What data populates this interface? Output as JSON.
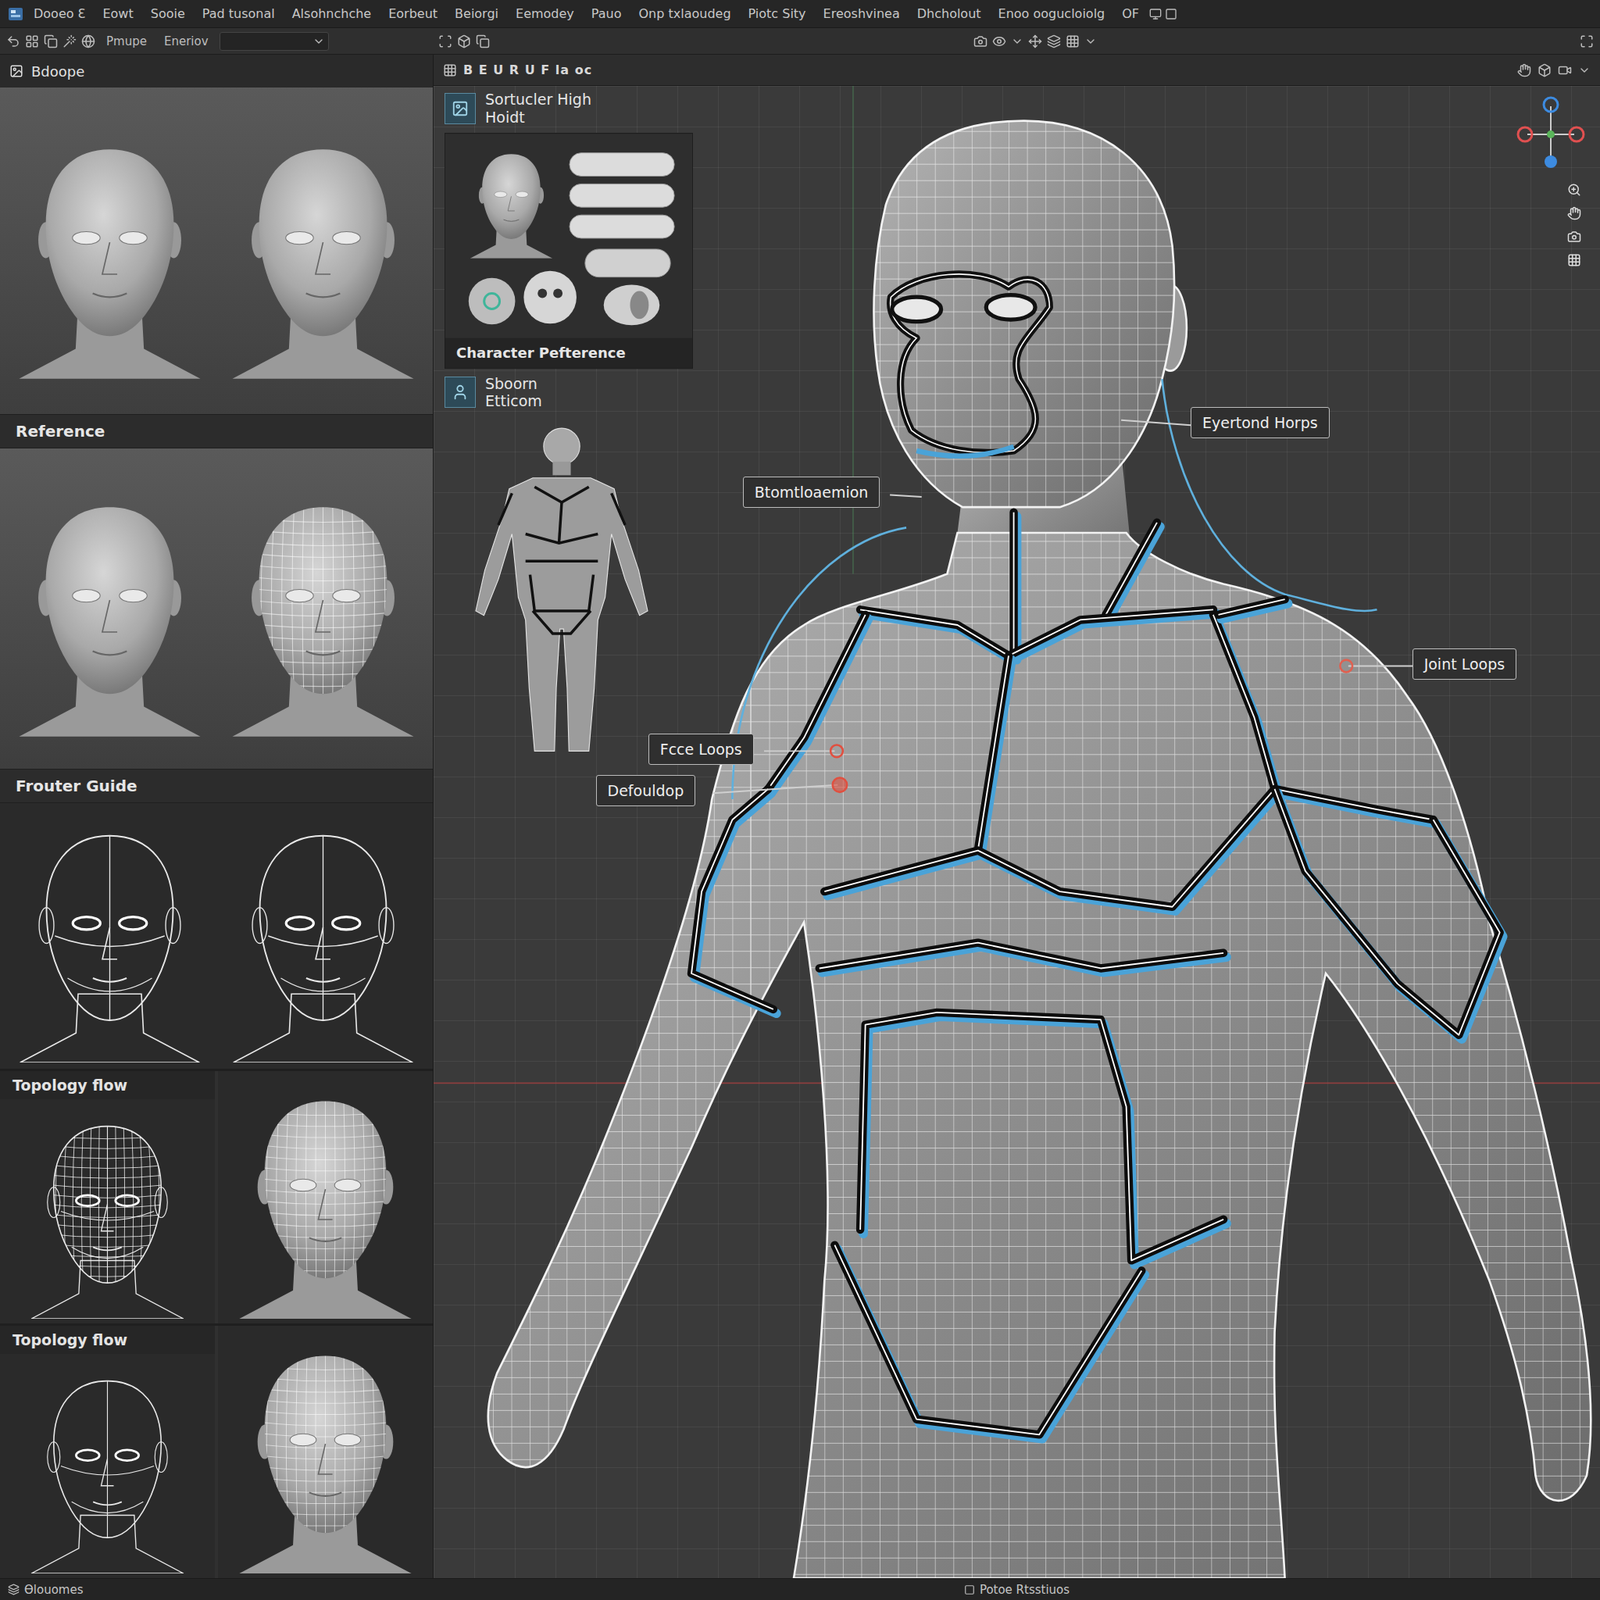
{
  "window": {
    "title": "Bdoope"
  },
  "menu": [
    "Dooeo Ɛ",
    "Eowt",
    "Sooie",
    "Pad tusonal",
    "Alsohnchche",
    "Eorbeut",
    "Beiorgi",
    "Eemodey",
    "Pauo",
    "Onp txlaoudeg",
    "Piotc Sity",
    "Ereoshvinea",
    "Dhcholout",
    "Enoo oogucloiolg",
    "OF"
  ],
  "toolbar": {
    "labels": [
      "Pmupe",
      "Eneriov"
    ]
  },
  "left_panel": {
    "title": "Bdoope",
    "sections": [
      {
        "heads": [
          {
            "kind": "solid"
          },
          {
            "kind": "solid"
          }
        ],
        "caption": "Reference"
      },
      {
        "heads": [
          {
            "kind": "solid"
          },
          {
            "kind": "mesh"
          }
        ],
        "caption": "Frouter Guide"
      },
      {
        "heads": [
          {
            "kind": "line"
          },
          {
            "kind": "line"
          }
        ],
        "caption": ""
      }
    ],
    "grid": [
      {
        "label": "Topology flow",
        "heads": [
          {
            "kind": "wire"
          },
          {
            "kind": "mesh"
          }
        ]
      },
      {
        "label": "Topology flow",
        "heads": [
          {
            "kind": "line"
          },
          {
            "kind": "mesh"
          }
        ]
      }
    ]
  },
  "viewport": {
    "header": "B E U R U F la oc",
    "cards": [
      {
        "title": [
          "Sortucler High",
          "Hoidt"
        ],
        "caption": "Character Pefterence",
        "kind": "reference"
      },
      {
        "title": [
          "Sboorn",
          "Etticom"
        ],
        "caption": "",
        "kind": "body"
      }
    ],
    "callouts": [
      {
        "label": "Eyertond Horps"
      },
      {
        "label": "Btomtloaemion"
      },
      {
        "label": "Joint Loops"
      },
      {
        "label": "Fcce Loops"
      },
      {
        "label": "Defouldop"
      }
    ]
  },
  "status_bar": {
    "left": "Ɵlouomes",
    "center": "Potoe Rtsstiuos"
  }
}
